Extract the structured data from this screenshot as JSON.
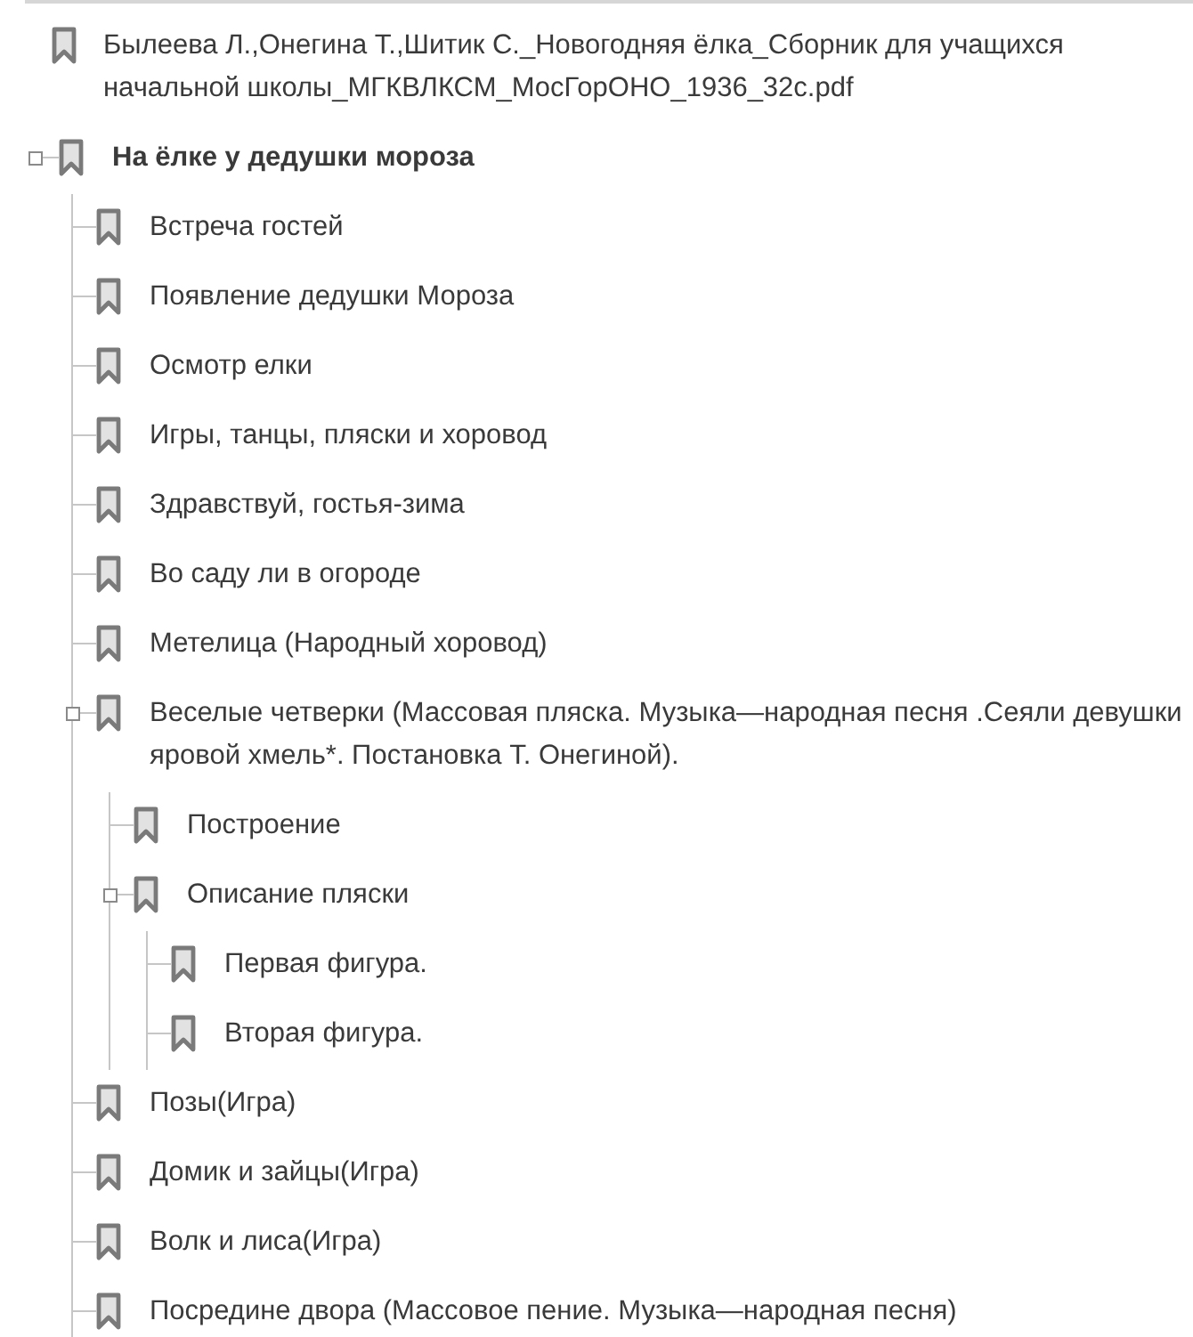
{
  "document": {
    "label": "Былеева Л.,Онегина Т.,Шитик С._Новогодняя ёлка_Сборник для учащихся начальной школы_МГКВЛКСМ_МосГорОНО_1936_32с.pdf"
  },
  "bookmarks": [
    {
      "label": "На ёлке у дедушки мороза",
      "expanded": true,
      "children": [
        {
          "label": "Встреча гостей"
        },
        {
          "label": "Появление дедушки Мороза"
        },
        {
          "label": "Осмотр елки"
        },
        {
          "label": "Игры, танцы, пляски и хоровод"
        },
        {
          "label": "Здравствуй, гостья-зима"
        },
        {
          "label": "Во саду ли в огороде"
        },
        {
          "label": "Метелица (Народный хоровод)"
        },
        {
          "label": "Веселые четверки (Массовая пляска. Музыка—народная песня .Сеяли девушки яровой хмель*. Постановка Т. Онегиной).",
          "expanded": true,
          "children": [
            {
              "label": "Построение"
            },
            {
              "label": "Описание пляски",
              "expanded": true,
              "children": [
                {
                  "label": "Первая фигура."
                },
                {
                  "label": "Вторая фигура."
                }
              ]
            }
          ]
        },
        {
          "label": "Позы(Игра)"
        },
        {
          "label": "Домик и зайцы(Игра)"
        },
        {
          "label": "Волк и лиса(Игра)"
        },
        {
          "label": "Посредине двора (Массовое пение. Музыка—народная песня)"
        }
      ]
    }
  ]
}
